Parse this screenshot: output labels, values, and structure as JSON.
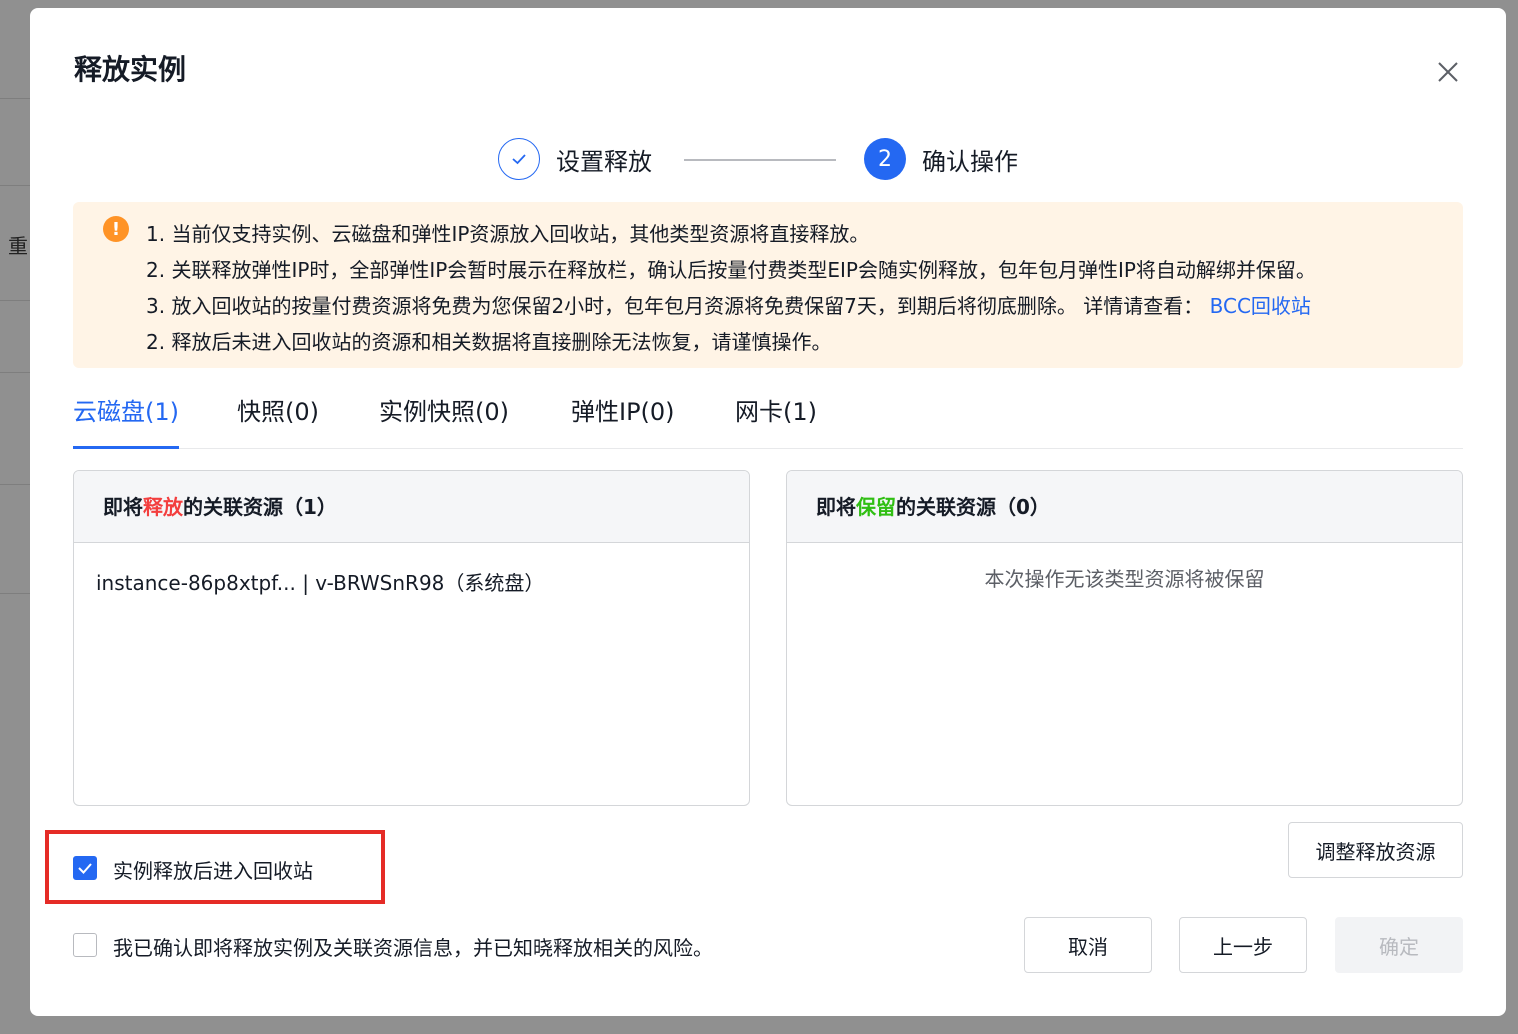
{
  "background": {
    "partial_text": "重"
  },
  "modal": {
    "title": "释放实例",
    "close_icon": "close-icon"
  },
  "steps": [
    {
      "label": "设置释放",
      "status": "done"
    },
    {
      "label": "确认操作",
      "status": "active",
      "number": "2"
    }
  ],
  "alert": {
    "icon": "!",
    "lines": [
      "1. 当前仅支持实例、云磁盘和弹性IP资源放入回收站，其他类型资源将直接释放。",
      "2. 关联释放弹性IP时，全部弹性IP会暂时展示在释放栏，确认后按量付费类型EIP会随实例释放，包年包月弹性IP将自动解绑并保留。",
      "3. 放入回收站的按量付费资源将免费为您保留2小时，包年包月资源将免费保留7天，到期后将彻底删除。 详情请查看：",
      "2. 释放后未进入回收站的资源和相关数据将直接删除无法恢复，请谨慎操作。"
    ],
    "link": "BCC回收站"
  },
  "tabs": [
    {
      "label": "云磁盘(1)",
      "active": true
    },
    {
      "label": "快照(0)",
      "active": false
    },
    {
      "label": "实例快照(0)",
      "active": false
    },
    {
      "label": "弹性IP(0)",
      "active": false
    },
    {
      "label": "网卡(1)",
      "active": false
    }
  ],
  "release_panel": {
    "title_prefix": "即将",
    "title_highlight": "释放",
    "title_suffix": "的关联资源（1）",
    "items": [
      "instance-86p8xtpf... | v-BRWSnR98（系统盘）"
    ]
  },
  "keep_panel": {
    "title_prefix": "即将",
    "title_highlight": "保留",
    "title_suffix": "的关联资源（0）",
    "empty_text": "本次操作无该类型资源将被保留"
  },
  "adjust_button": "调整释放资源",
  "recycle_checkbox": {
    "label": "实例释放后进入回收站",
    "checked": true
  },
  "confirm_checkbox": {
    "label": "我已确认即将释放实例及关联资源信息，并已知晓释放相关的风险。",
    "checked": false
  },
  "footer": {
    "cancel": "取消",
    "prev": "上一步",
    "ok": "确定"
  },
  "colors": {
    "primary": "#2468f2",
    "warning": "#ff9326",
    "danger": "#f33e3e",
    "success": "#30bf13",
    "highlight_border": "#e52b26"
  }
}
